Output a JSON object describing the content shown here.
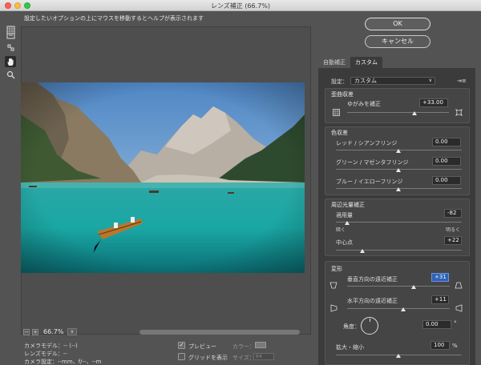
{
  "window": {
    "title": "レンズ補正 (66.7%)"
  },
  "hint": "設定したいオプションの上にマウスを移動するとヘルプが表示されます",
  "tools": [
    "remove-distortion-tool",
    "straighten-tool",
    "move-grid-tool",
    "hand-tool",
    "zoom-tool"
  ],
  "zoom": {
    "value": "66.7%",
    "minus": "−",
    "plus": "+",
    "dropdown": "∨"
  },
  "camera": {
    "model": "カメラモデル：-- (--)",
    "lens": "レンズモデル：--",
    "settings": "カメラ設定：--mm、f/--、--m"
  },
  "options": {
    "preview": "プレビュー",
    "preview_checked": "✓",
    "show_grid": "グリッドを表示",
    "color": "カラー：",
    "size": "サイズ：",
    "size_value": "64"
  },
  "buttons": {
    "ok": "OK",
    "cancel": "キャンセル"
  },
  "tabs": {
    "auto": "自動補正",
    "custom": "カスタム"
  },
  "settings": {
    "label": "設定：",
    "value": "カスタム",
    "arrow": "∨",
    "menu_icon": "⇥≡"
  },
  "distortion": {
    "title": "歪曲収差",
    "label": "ゆがみを補正",
    "value": "+33.00",
    "fraction": 0.67
  },
  "chromatic": {
    "title": "色収差",
    "rows": [
      {
        "label": "レッド / シアンフリンジ",
        "value": "0.00",
        "fraction": 0.5
      },
      {
        "label": "グリーン / マゼンタフリンジ",
        "value": "0.00",
        "fraction": 0.5
      },
      {
        "label": "ブルー / イエローフリンジ",
        "value": "0.00",
        "fraction": 0.5
      }
    ]
  },
  "vignette": {
    "title": "周辺光量補正",
    "amount_label": "適用量",
    "amount_value": "-82",
    "amount_fraction": 0.09,
    "darken": "暗く",
    "lighten": "明るく",
    "midpoint_label": "中心点",
    "midpoint_value": "+22",
    "midpoint_fraction": 0.61
  },
  "transform": {
    "title": "変形",
    "vertical_label": "垂直方向の遠近補正",
    "vertical_value": "+31",
    "vertical_fraction": 0.65,
    "horizontal_label": "水平方向の遠近補正",
    "horizontal_value": "+11",
    "horizontal_fraction": 0.55,
    "angle_label": "角度：",
    "angle_value": "0.00",
    "angle_unit": "°",
    "scale_label": "拡大・縮小",
    "scale_value": "100",
    "scale_unit": "%",
    "scale_fraction": 0.5
  }
}
